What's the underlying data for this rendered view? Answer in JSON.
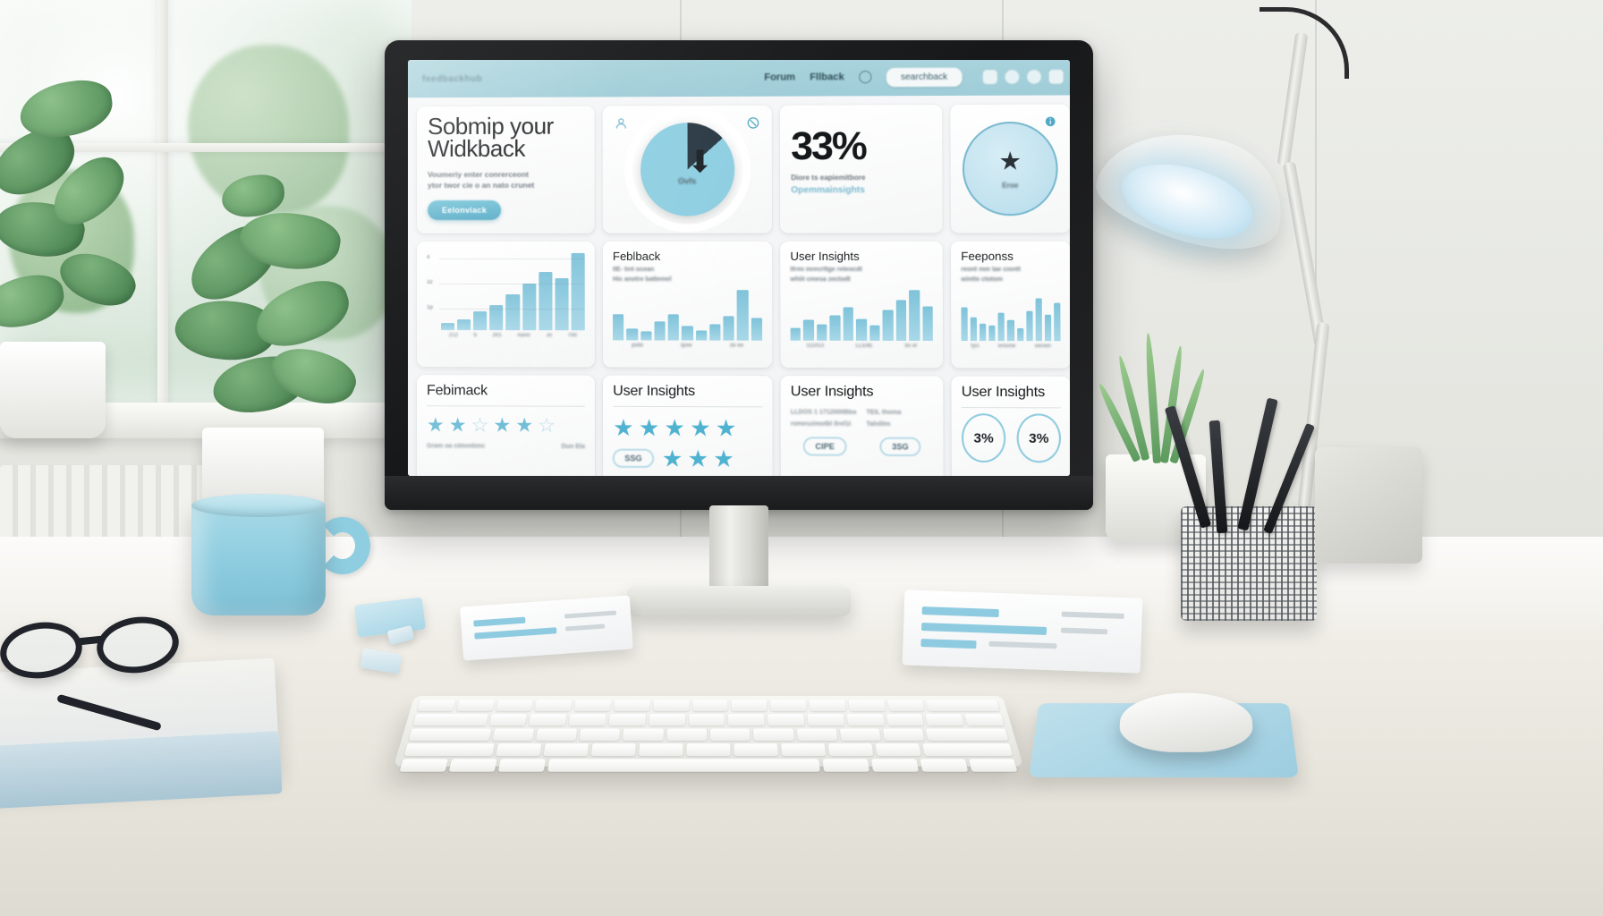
{
  "scene": {
    "description": "Photorealistic office desk with iMac-style monitor showing a feedback analytics dashboard",
    "objects": [
      "window",
      "potted-plant-left",
      "potted-plant-desk",
      "monitor",
      "desk-lamp",
      "coffee-mug",
      "keyboard",
      "mouse",
      "mousepad",
      "eyeglasses",
      "notebook",
      "pen-holder",
      "succulent",
      "paper-notes",
      "sticky-note",
      "eraser",
      "radiator"
    ]
  },
  "dashboard": {
    "topbar": {
      "brand": "feedbackhub",
      "nav": [
        {
          "label": "Forum"
        },
        {
          "label": "Fllback"
        }
      ],
      "bell_icon": "bell-icon",
      "search": {
        "placeholder": "searchback",
        "value": "searchback"
      },
      "actions": [
        {
          "icon": "grid-icon"
        },
        {
          "icon": "notifications-icon"
        },
        {
          "icon": "profile-icon"
        },
        {
          "icon": "settings-icon"
        }
      ],
      "bg_color": "#a9d3dc"
    },
    "hero": {
      "title_line1": "Sobmip your",
      "title_line2": "Widkback",
      "body_line1": "Voumeriy enter conrerceont",
      "body_line2": "ytor twor cie o an nato crunet",
      "cta_label": "Eelonviack",
      "cta_color": "#4fa8c4"
    },
    "kpi_donut": {
      "icon_left": "user-avatar-icon",
      "icon_right": "refresh-icon",
      "center_label": "Ovfs",
      "glyph": "arrow-down-icon",
      "segments": [
        {
          "name": "dark",
          "value": 13,
          "color": "#2b3a44"
        },
        {
          "name": "light",
          "value": 87,
          "color": "#8fcfe2"
        }
      ]
    },
    "kpi_stat": {
      "value": "33%",
      "caption": "Diore ts eapiemitbore",
      "link": "Opemmainsights"
    },
    "kpi_ring": {
      "icon": "info-icon",
      "glyph": "star-icon",
      "label": "Eroe",
      "accent": "#79b9cf"
    },
    "charts": [
      {
        "title": "",
        "subtitle": "",
        "type": "bar",
        "values": [
          8,
          13,
          22,
          30,
          42,
          56,
          70,
          62,
          92
        ],
        "categories": [
          "212",
          "ti",
          "201",
          "nano",
          "Js",
          "700",
          "",
          "",
          ""
        ],
        "yticks": [
          "4",
          "32",
          "1p"
        ],
        "color": "#7fc3da"
      },
      {
        "title": "Feblback",
        "subtitle_line1": "0E- tint ocean",
        "subtitle_line2": "Hic anotre battemel",
        "type": "bar",
        "values": [
          48,
          22,
          16,
          35,
          48,
          26,
          18,
          30,
          44,
          74,
          40
        ],
        "categories": [
          "pidb",
          "Ipoe",
          "3e ee"
        ],
        "color": "#7fc3da"
      },
      {
        "title": "User Insights",
        "subtitle_line1": "Ifrmi mrecrttge reteocdt",
        "subtitle_line2": "whiit cmesa zectodt",
        "type": "bar",
        "values": [
          22,
          36,
          28,
          44,
          58,
          38,
          26,
          54,
          70,
          88,
          60
        ],
        "categories": [
          "111013",
          "LLEIIE",
          "3o el"
        ],
        "color": "#7fc3da"
      },
      {
        "title": "Feeponss",
        "subtitle_line1": "reont mm tae ciontt",
        "subtitle_line2": "wintte ctotom",
        "type": "bar",
        "values": [
          58,
          40,
          30,
          26,
          48,
          36,
          22,
          52,
          74,
          46,
          66
        ],
        "categories": [
          "tyu",
          "ensine",
          "serien"
        ],
        "color": "#7fc3da"
      }
    ],
    "bottom_cards": [
      {
        "title": "Febimack",
        "kind": "star-rating",
        "stars_filled": 4,
        "stars_total": 6,
        "footer_left": "Gram oa cilmnitimc",
        "footer_right": "Dun Ela"
      },
      {
        "title": "User Insights",
        "kind": "star-rating-pills",
        "stars_filled": 5,
        "stars_total": 5,
        "pills": [
          "SSG",
          "",
          ""
        ]
      },
      {
        "title": "User Insights",
        "kind": "pills",
        "meta_left_1": "LLDOS 1 1712000Bba",
        "meta_left_2": "romeszimotbl Ilrel1t",
        "meta_right_1": "TEIL thoma",
        "meta_right_2": "Talnlitm",
        "pills": [
          "CIPE",
          "3SG"
        ]
      },
      {
        "title": "User Insights",
        "kind": "percent-circles",
        "circles": [
          {
            "value": "3%"
          },
          {
            "value": "3%"
          }
        ]
      }
    ]
  }
}
